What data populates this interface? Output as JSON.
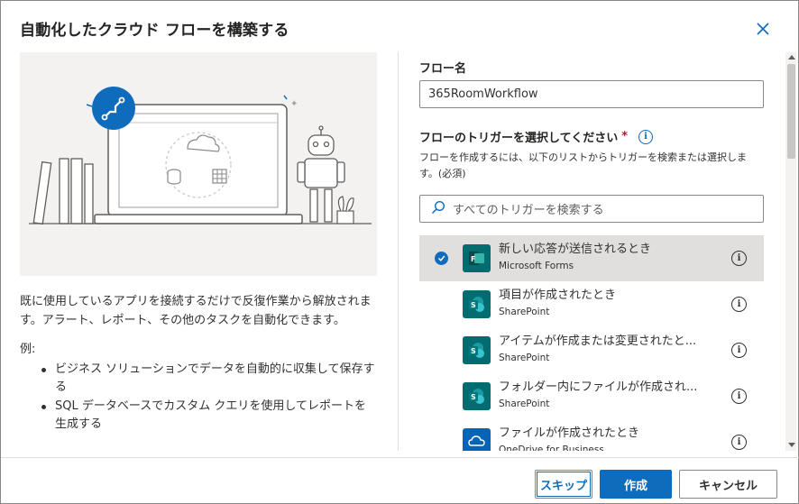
{
  "dialog": {
    "title": "自動化したクラウド フローを構築する"
  },
  "left": {
    "description": "既に使用しているアプリを接続するだけで反復作業から解放されます。アラート、レポート、その他のタスクを自動化できます。",
    "example_label": "例:",
    "examples": [
      "ビジネス ソリューションでデータを自動的に収集して保存する",
      "SQL データベースでカスタム クエリを使用してレポートを生成する"
    ]
  },
  "form": {
    "flow_name_label": "フロー名",
    "flow_name_value": "365RoomWorkflow",
    "trigger_label": "フローのトリガーを選択してください",
    "required_mark": "*",
    "trigger_help": "フローを作成するには、以下のリストからトリガーを検索または選択します。(必須)",
    "search_placeholder": "すべてのトリガーを検索する"
  },
  "triggers": [
    {
      "name": "新しい応答が送信されるとき",
      "connector": "Microsoft Forms",
      "selected": true,
      "icon": "forms-icon",
      "color": "#036c70"
    },
    {
      "name": "項目が作成されたとき",
      "connector": "SharePoint",
      "selected": false,
      "icon": "sharepoint-icon",
      "color": "#036c70"
    },
    {
      "name": "アイテムが作成または変更されたと...",
      "connector": "SharePoint",
      "selected": false,
      "icon": "sharepoint-icon",
      "color": "#036c70"
    },
    {
      "name": "フォルダー内にファイルが作成され...",
      "connector": "SharePoint",
      "selected": false,
      "icon": "sharepoint-icon",
      "color": "#036c70"
    },
    {
      "name": "ファイルが作成されたとき",
      "connector": "OneDrive for Business",
      "selected": false,
      "icon": "onedrive-icon",
      "color": "#0364b8"
    }
  ],
  "footer": {
    "skip_label": "スキップ",
    "create_label": "作成",
    "cancel_label": "キャンセル"
  },
  "colors": {
    "accent": "#0f6cbd",
    "selected_row": "#e1dfdd",
    "illustration_bg": "#f3f2f1"
  }
}
